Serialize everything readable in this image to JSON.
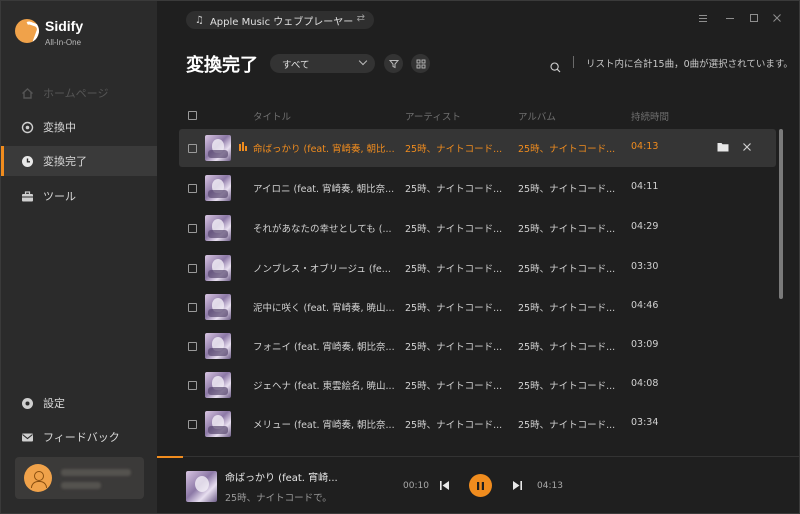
{
  "app": {
    "name": "Sidify",
    "subtitle": "All-In-One",
    "source": "Apple Music ウェブプレーヤー"
  },
  "sidebar": {
    "items": [
      {
        "label": "ホームページ",
        "icon": "home-icon",
        "state": "disabled"
      },
      {
        "label": "変換中",
        "icon": "converting-icon",
        "state": "normal"
      },
      {
        "label": "変換完了",
        "icon": "clock-icon",
        "state": "active"
      },
      {
        "label": "ツール",
        "icon": "toolbox-icon",
        "state": "normal"
      }
    ],
    "bottom": [
      {
        "label": "設定",
        "icon": "gear-icon"
      },
      {
        "label": "フィードバック",
        "icon": "mail-icon"
      }
    ]
  },
  "main": {
    "title": "変換完了",
    "filter": "すべて",
    "status": "リスト内に合計15曲，0曲が選択されています。",
    "columns": {
      "title": "タイトル",
      "artist": "アーティスト",
      "album": "アルバム",
      "duration": "持続時間"
    },
    "rows": [
      {
        "title": "命ばっかり (feat. 宵崎奏, 朝比...",
        "artist": "25時、ナイトコード...",
        "album": "25時、ナイトコード...",
        "duration": "04:13"
      },
      {
        "title": "アイロニ (feat. 宵崎奏, 朝比奈...",
        "artist": "25時、ナイトコード...",
        "album": "25時、ナイトコード...",
        "duration": "04:11"
      },
      {
        "title": "それがあなたの幸せとしても (...",
        "artist": "25時、ナイトコード...",
        "album": "25時、ナイトコード...",
        "duration": "04:29"
      },
      {
        "title": "ノンブレス・オブリージュ (fe...",
        "artist": "25時、ナイトコード...",
        "album": "25時、ナイトコード...",
        "duration": "03:30"
      },
      {
        "title": "泥中に咲く (feat. 宵崎奏, 暁山...",
        "artist": "25時、ナイトコード...",
        "album": "25時、ナイトコード...",
        "duration": "04:46"
      },
      {
        "title": "フォニイ (feat. 宵崎奏, 朝比奈...",
        "artist": "25時、ナイトコード...",
        "album": "25時、ナイトコード...",
        "duration": "03:09"
      },
      {
        "title": "ジェヘナ (feat. 東雲絵名, 暁山...",
        "artist": "25時、ナイトコード...",
        "album": "25時、ナイトコード...",
        "duration": "04:08"
      },
      {
        "title": "メリュー (feat. 宵崎奏, 朝比奈...",
        "artist": "25時、ナイトコード...",
        "album": "25時、ナイトコード...",
        "duration": "03:34"
      }
    ]
  },
  "player": {
    "title": "命ばっかり (feat. 宵崎...",
    "artist": "25時、ナイトコードで。",
    "elapsed": "00:10",
    "total": "04:13",
    "progress": 0.04
  },
  "colors": {
    "accent": "#f08c1e",
    "sidebar_bg": "#2b2b2b",
    "main_bg": "#1f1f1f"
  }
}
